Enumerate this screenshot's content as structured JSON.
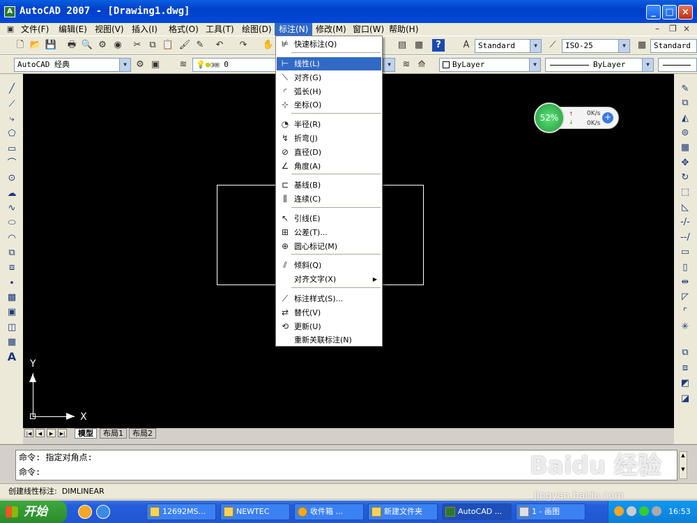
{
  "window": {
    "title": "AutoCAD 2007 - [Drawing1.dwg]",
    "icon_label": "A",
    "min": "_",
    "max": "□",
    "close": "×"
  },
  "menubar": {
    "items": [
      "文件(F)",
      "编辑(E)",
      "视图(V)",
      "插入(I)",
      "格式(O)",
      "工具(T)",
      "绘图(D)",
      "标注(N)",
      "修改(M)",
      "窗口(W)",
      "帮助(H)"
    ],
    "mdi_min": "–",
    "mdi_restore": "❐",
    "mdi_close": "×"
  },
  "toolbar": {
    "text_style": "Standard",
    "dim_style": "ISO-25",
    "table_style": "Standard",
    "workspace": "AutoCAD 经典",
    "layer": "0",
    "color": "ByLayer",
    "linetype": "ByLayer"
  },
  "dim_menu": {
    "items": [
      {
        "label": "快速标注(Q)",
        "icon": "quick-dim-icon"
      },
      {
        "label": "线性(L)",
        "icon": "linear-icon"
      },
      {
        "label": "对齐(G)",
        "icon": "aligned-icon"
      },
      {
        "label": "弧长(H)",
        "icon": "arc-length-icon"
      },
      {
        "label": "坐标(O)",
        "icon": "ordinate-icon"
      },
      {
        "label": "半径(R)",
        "icon": "radius-icon"
      },
      {
        "label": "折弯(J)",
        "icon": "jogged-icon"
      },
      {
        "label": "直径(D)",
        "icon": "diameter-icon"
      },
      {
        "label": "角度(A)",
        "icon": "angular-icon"
      },
      {
        "label": "基线(B)",
        "icon": "baseline-icon"
      },
      {
        "label": "连续(C)",
        "icon": "continue-icon"
      },
      {
        "label": "引线(E)",
        "icon": "leader-icon"
      },
      {
        "label": "公差(T)...",
        "icon": "tolerance-icon"
      },
      {
        "label": "圆心标记(M)",
        "icon": "center-mark-icon"
      },
      {
        "label": "倾斜(Q)",
        "icon": "oblique-icon"
      },
      {
        "label": "对齐文字(X)",
        "icon": ""
      },
      {
        "label": "标注样式(S)...",
        "icon": "dim-style-icon"
      },
      {
        "label": "替代(V)",
        "icon": "override-icon"
      },
      {
        "label": "更新(U)",
        "icon": "update-icon"
      },
      {
        "label": "重新关联标注(N)",
        "icon": ""
      }
    ],
    "highlighted": "线性(L)"
  },
  "netwidget": {
    "percent": "52%",
    "up": "0K/s",
    "down": "0K/s",
    "plus": "+"
  },
  "ucs": {
    "y": "Y",
    "x": "X"
  },
  "layout_tabs": [
    "模型",
    "布局1",
    "布局2"
  ],
  "command": {
    "line1": "命令: 指定对角点:",
    "line2": "命令:"
  },
  "status": {
    "text": "创建线性标注:  DIMLINEAR"
  },
  "taskbar": {
    "start": "开始",
    "tasks": [
      "12692MS...",
      "NEWTEC",
      "收件箱 ...",
      "新建文件夹",
      "AutoCAD ...",
      "1 - 画图"
    ],
    "clock": "16:53"
  },
  "watermark": {
    "logo": "Baidu 经验",
    "url": "jingyan.baidu.com"
  }
}
